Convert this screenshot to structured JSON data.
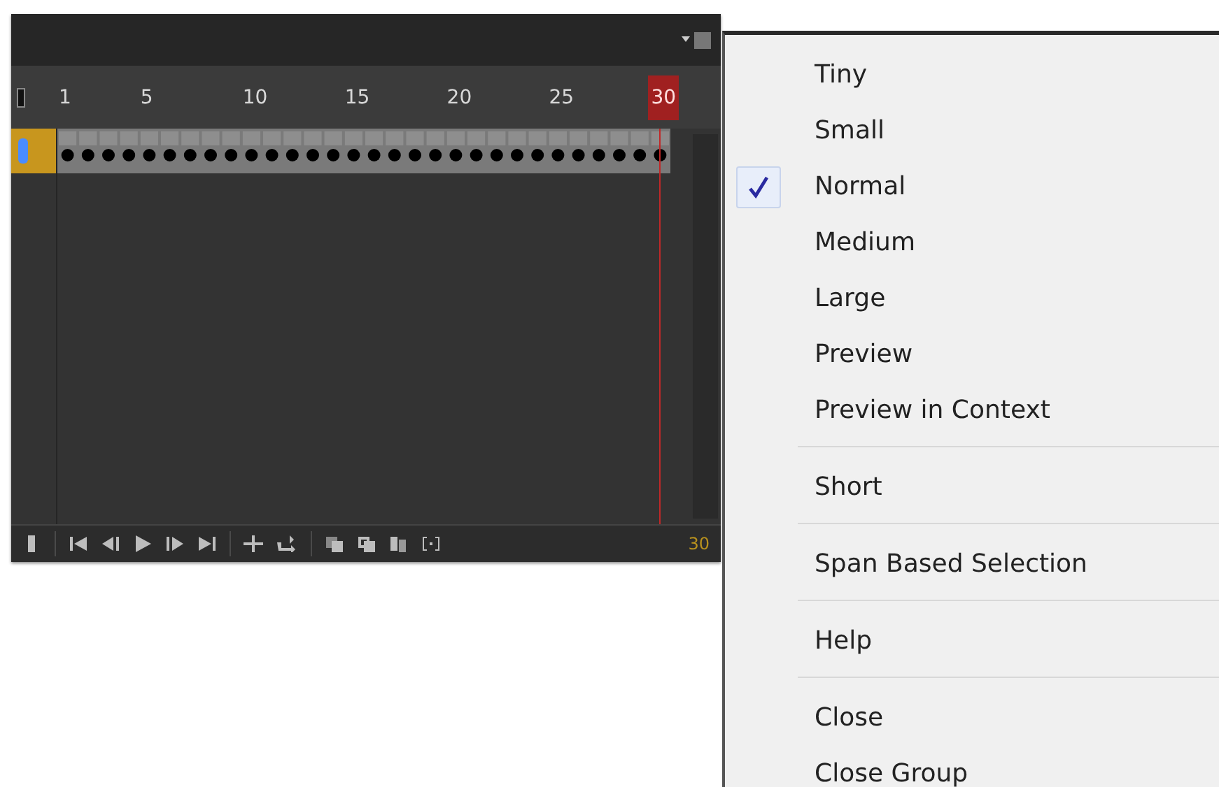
{
  "timeline": {
    "ruler": [
      {
        "label": "1",
        "selected": false
      },
      {
        "label": "5",
        "selected": false
      },
      {
        "label": "10",
        "selected": false
      },
      {
        "label": "15",
        "selected": false
      },
      {
        "label": "20",
        "selected": false
      },
      {
        "label": "25",
        "selected": false
      },
      {
        "label": "30",
        "selected": true
      }
    ],
    "current_frame": "30"
  },
  "menu": {
    "groups": [
      [
        {
          "label": "Tiny",
          "checked": false
        },
        {
          "label": "Small",
          "checked": false
        },
        {
          "label": "Normal",
          "checked": true
        },
        {
          "label": "Medium",
          "checked": false
        },
        {
          "label": "Large",
          "checked": false
        },
        {
          "label": "Preview",
          "checked": false
        },
        {
          "label": "Preview in Context",
          "checked": false
        }
      ],
      [
        {
          "label": "Short",
          "checked": false
        }
      ],
      [
        {
          "label": "Span Based Selection",
          "checked": false
        }
      ],
      [
        {
          "label": "Help",
          "checked": false
        }
      ],
      [
        {
          "label": "Close",
          "checked": false
        },
        {
          "label": "Close Group",
          "checked": false
        }
      ]
    ]
  }
}
